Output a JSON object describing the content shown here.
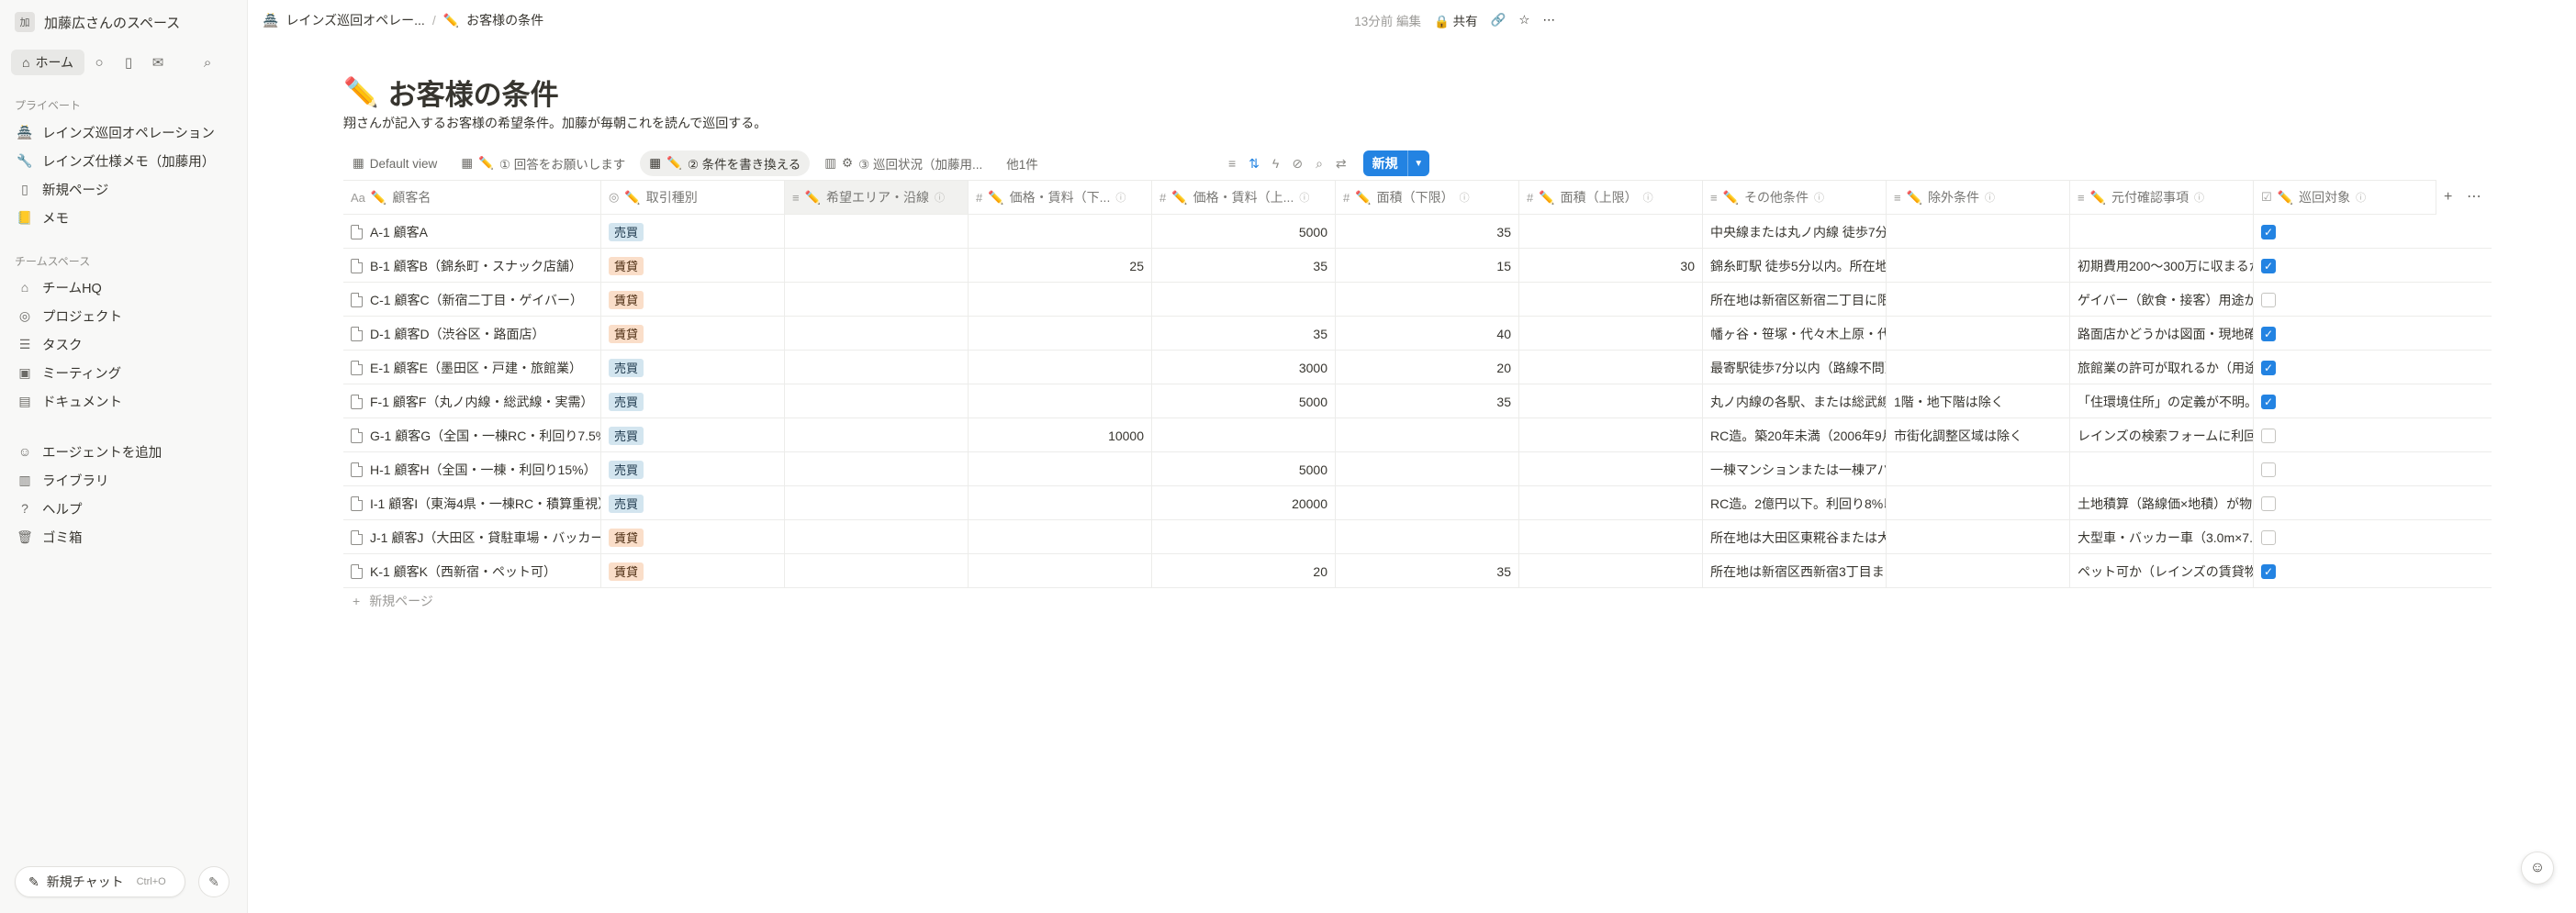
{
  "sidebar": {
    "workspace": {
      "avatar": "加",
      "name": "加藤広さんのスペース"
    },
    "home_label": "ホーム",
    "icons": [
      "chat-icon",
      "inbox-doc-icon",
      "mail-icon",
      "search-icon"
    ],
    "private_title": "プライベート",
    "private_items": [
      {
        "icon": "building-icon",
        "label": "レインズ巡回オペレーション"
      },
      {
        "icon": "wrench-icon",
        "label": "レインズ仕様メモ（加藤用）"
      },
      {
        "icon": "page-icon",
        "label": "新規ページ"
      },
      {
        "icon": "memo-icon",
        "label": "メモ"
      }
    ],
    "team_title": "チームスペース",
    "team_items": [
      {
        "icon": "home-icon",
        "label": "チームHQ"
      },
      {
        "icon": "target-icon",
        "label": "プロジェクト"
      },
      {
        "icon": "checklist-icon",
        "label": "タスク"
      },
      {
        "icon": "calendar-icon",
        "label": "ミーティング"
      },
      {
        "icon": "document-icon",
        "label": "ドキュメント"
      }
    ],
    "bottom_items": [
      {
        "icon": "face-icon",
        "label": "エージェントを追加"
      },
      {
        "icon": "library-icon",
        "label": "ライブラリ"
      },
      {
        "icon": "help-icon",
        "label": "ヘルプ"
      },
      {
        "icon": "trash-icon",
        "label": "ゴミ箱"
      }
    ],
    "new_chat": {
      "label": "新規チャット",
      "shortcut": "Ctrl+O"
    }
  },
  "topbar": {
    "breadcrumb": [
      "レインズ巡回オペレー...",
      "お客様の条件"
    ],
    "edited": "13分前 編集",
    "share_label": "共有"
  },
  "page": {
    "title": "お客様の条件",
    "description": "翔さんが記入するお客様の希望条件。加藤が毎朝これを読んで巡回する。"
  },
  "views": {
    "tabs": [
      {
        "label": "Default view",
        "active": false
      },
      {
        "label": "① 回答をお願いします",
        "active": false
      },
      {
        "label": "② 条件を書き換える",
        "active": true
      },
      {
        "label": "③ 巡回状況（加藤用...",
        "active": false
      }
    ],
    "more": "他1件",
    "new_label": "新規"
  },
  "table": {
    "columns": [
      {
        "label": "顧客名",
        "icon": "Aa"
      },
      {
        "label": "取引種別",
        "icon": "◎"
      },
      {
        "label": "希望エリア・沿線",
        "icon": "≡"
      },
      {
        "label": "価格・賃料（下...",
        "icon": "#"
      },
      {
        "label": "価格・賃料（上...",
        "icon": "#"
      },
      {
        "label": "面積（下限）",
        "icon": "#"
      },
      {
        "label": "面積（上限）",
        "icon": "#"
      },
      {
        "label": "その他条件",
        "icon": "≡"
      },
      {
        "label": "除外条件",
        "icon": "≡"
      },
      {
        "label": "元付確認事項",
        "icon": "≡"
      },
      {
        "label": "巡回対象",
        "icon": "☑"
      }
    ],
    "rows": [
      {
        "name": "A-1 顧客A",
        "type": "売買",
        "area": "",
        "price_min": "",
        "price_max": "5000",
        "area_min": "35",
        "area_max": "",
        "other": "中央線または丸ノ内線 徒歩7分",
        "exclude": "",
        "confirm": "",
        "patrol": true
      },
      {
        "name": "B-1 顧客B（錦糸町・スナック店舗）",
        "type": "賃貸",
        "area": "",
        "price_min": "25",
        "price_max": "35",
        "area_min": "15",
        "area_max": "30",
        "other": "錦糸町駅 徒歩5分以内。所在地",
        "exclude": "",
        "confirm": "初期費用200〜300万に収まるか",
        "patrol": true
      },
      {
        "name": "C-1 顧客C（新宿二丁目・ゲイバー）",
        "type": "賃貸",
        "area": "",
        "price_min": "",
        "price_max": "",
        "area_min": "",
        "area_max": "",
        "other": "所在地は新宿区新宿二丁目に限",
        "exclude": "",
        "confirm": "ゲイバー（飲食・接客）用途か",
        "patrol": false
      },
      {
        "name": "D-1 顧客D（渋谷区・路面店）",
        "type": "賃貸",
        "area": "",
        "price_min": "",
        "price_max": "35",
        "area_min": "40",
        "area_max": "",
        "other": "幡ヶ谷・笹塚・代々木上原・代",
        "exclude": "",
        "confirm": "路面店かどうかは図面・現地確",
        "patrol": true
      },
      {
        "name": "E-1 顧客E（墨田区・戸建・旅館業）",
        "type": "売買",
        "area": "",
        "price_min": "",
        "price_max": "3000",
        "area_min": "20",
        "area_max": "",
        "other": "最寄駅徒歩7分以内（路線不問）",
        "exclude": "",
        "confirm": "旅館業の許可が取れるか（用途",
        "patrol": true
      },
      {
        "name": "F-1 顧客F（丸ノ内線・総武線・実需）",
        "type": "売買",
        "area": "",
        "price_min": "",
        "price_max": "5000",
        "area_min": "35",
        "area_max": "",
        "other": "丸ノ内線の各駅、または総武線",
        "exclude": "1階・地下階は除く",
        "confirm": "「住環境住所」の定義が不明。",
        "patrol": true
      },
      {
        "name": "G-1 顧客G（全国・一棟RC・利回り7.5%）",
        "type": "売買",
        "area": "",
        "price_min": "10000",
        "price_max": "",
        "area_min": "",
        "area_max": "",
        "other": "RC造。築20年未満（2006年9月",
        "exclude": "市街化調整区域は除く",
        "confirm": "レインズの検索フォームに利回",
        "patrol": false
      },
      {
        "name": "H-1 顧客H（全国・一棟・利回り15%）",
        "type": "売買",
        "area": "",
        "price_min": "",
        "price_max": "5000",
        "area_min": "",
        "area_max": "",
        "other": "一棟マンションまたは一棟アパ",
        "exclude": "",
        "confirm": "",
        "patrol": false
      },
      {
        "name": "I-1 顧客I（東海4県・一棟RC・積算重視）",
        "type": "売買",
        "area": "",
        "price_min": "",
        "price_max": "20000",
        "area_min": "",
        "area_max": "",
        "other": "RC造。2億円以下。利回り8%以",
        "exclude": "",
        "confirm": "土地積算（路線価×地積）が物",
        "patrol": false
      },
      {
        "name": "J-1 顧客J（大田区・貸駐車場・バッカー）",
        "type": "賃貸",
        "area": "",
        "price_min": "",
        "price_max": "",
        "area_min": "",
        "area_max": "",
        "other": "所在地は大田区東糀谷または大",
        "exclude": "",
        "confirm": "大型車・バッカー車（3.0m×7.",
        "patrol": false
      },
      {
        "name": "K-1 顧客K（西新宿・ペット可）",
        "type": "賃貸",
        "area": "",
        "price_min": "",
        "price_max": "20",
        "area_min": "35",
        "area_max": "",
        "other": "所在地は新宿区西新宿3丁目ま",
        "exclude": "",
        "confirm": "ペット可か（レインズの賃貸物",
        "patrol": true
      }
    ],
    "add_row_label": "新規ページ"
  },
  "colors": {
    "accent": "#2383e2",
    "buy_tag": "#d3e5ef",
    "rent_tag": "#fadec9"
  }
}
